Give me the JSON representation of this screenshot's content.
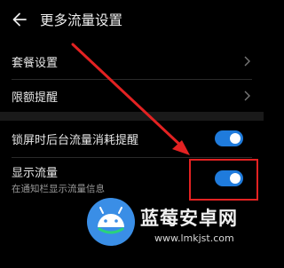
{
  "header": {
    "title": "更多流量设置",
    "back_icon": "arrow-left-icon"
  },
  "rows": [
    {
      "label": "套餐设置"
    },
    {
      "label": "限额提醒"
    }
  ],
  "toggles": [
    {
      "label": "锁屏时后台流量消耗提醒",
      "on": true
    },
    {
      "label": "显示流量",
      "subtitle": "在通知栏显示流量信息",
      "on": true
    }
  ],
  "colors": {
    "accent": "#1f7bdc",
    "annotation": "#e32222",
    "background": "#000000"
  },
  "watermark": {
    "text": "蓝莓安卓网",
    "url": "www.lmkjst.com"
  }
}
